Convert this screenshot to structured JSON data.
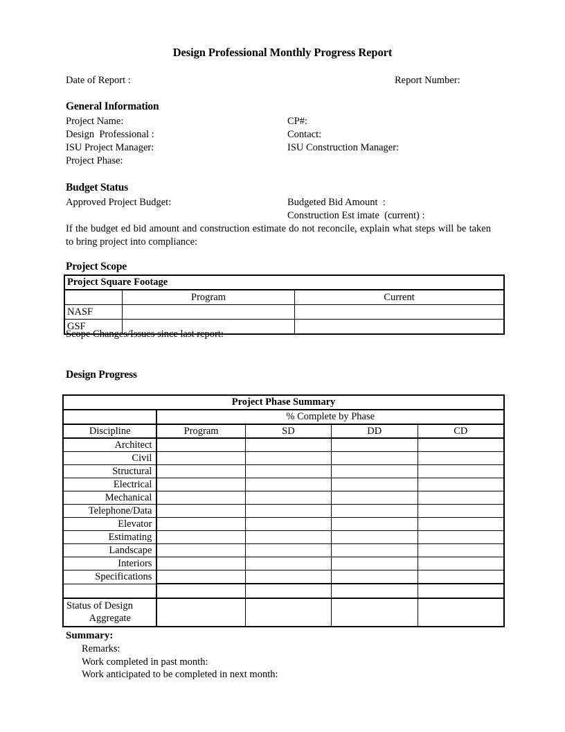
{
  "document": {
    "title": "Design Professional Monthly Progress Report",
    "date_of_report_label": "Date of Report :",
    "report_number_label": "Report Number:"
  },
  "general_information": {
    "heading": "General Information",
    "left_fields": [
      "Project Name:",
      "Design  Professional :",
      "ISU Project Manager:",
      "Project Phase:"
    ],
    "right_fields": [
      "CP#:",
      "Contact:",
      "ISU Construction Manager:"
    ]
  },
  "budget_status": {
    "heading": "Budget Status",
    "approved_budget_label": "Approved Project Budget:",
    "budgeted_bid_label": "Budgeted Bid Amount  :",
    "construction_estimate_label": "Construction Est imate  (current) :",
    "reconcile_note": "If the budget ed bid amount  and construction estimate do not reconcile,  explain what steps will be taken to bring project into compliance:"
  },
  "project_scope": {
    "heading": "Project Scope",
    "table_title": "Project Square Footage",
    "columns": [
      "",
      "Program",
      "Current"
    ],
    "rows": [
      {
        "label": "NASF",
        "program": "",
        "current": ""
      },
      {
        "label": "GSF",
        "program": "",
        "current": ""
      }
    ],
    "scope_changes_label": "Scope Changes/Issues since last report:"
  },
  "design_progress": {
    "heading": "Design Progress",
    "table_title": "Project Phase Summary",
    "percent_complete_label": "% Complete by Phase",
    "columns": [
      "Discipline",
      "Program",
      "SD",
      "DD",
      "CD"
    ],
    "disciplines": [
      "Architect",
      "Civil",
      "Structural",
      "Electrical",
      "Mechanical",
      "Telephone/Data",
      "Elevator",
      "Estimating",
      "Landscape",
      "Interiors",
      "Specifications"
    ],
    "aggregate_row": {
      "line1": "Status of Design",
      "line2": "Aggregate"
    }
  },
  "summary": {
    "heading": "Summary:",
    "lines": [
      "Remarks:",
      "Work completed in past month:",
      "Work anticipated to be completed in next month:"
    ]
  }
}
